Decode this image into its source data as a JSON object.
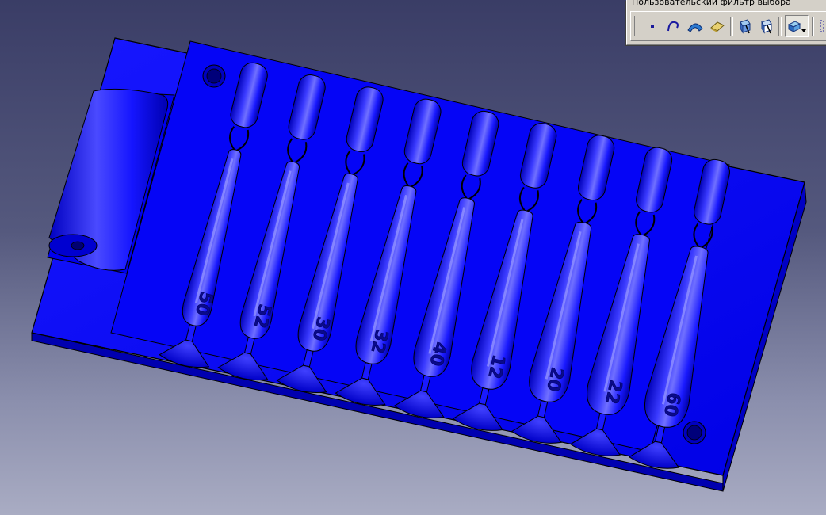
{
  "toolbar": {
    "title": "Пользовательский фильтр выбора",
    "buttons": [
      {
        "icon": "point-filter-icon"
      },
      {
        "icon": "curve-filter-icon"
      },
      {
        "icon": "surface-filter-icon"
      },
      {
        "icon": "volume-filter-icon"
      },
      {
        "icon": "feature-element-selection-icon"
      },
      {
        "icon": "geometrical-element-icon"
      },
      {
        "icon": "tools-palette-icon"
      },
      {
        "icon": "more-icon"
      }
    ]
  },
  "model": {
    "color": "#0a0aff",
    "cavity_labels": [
      "50",
      "52",
      "30",
      "32",
      "40",
      "12",
      "20",
      "22",
      "60"
    ]
  }
}
